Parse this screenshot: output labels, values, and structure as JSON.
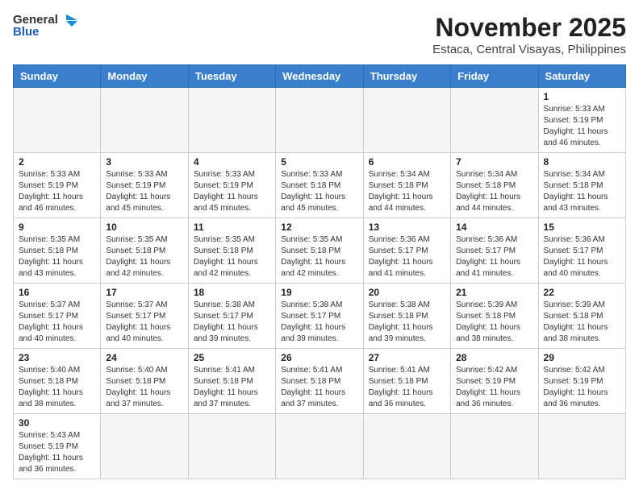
{
  "header": {
    "logo_general": "General",
    "logo_blue": "Blue",
    "month_title": "November 2025",
    "location": "Estaca, Central Visayas, Philippines"
  },
  "weekdays": [
    "Sunday",
    "Monday",
    "Tuesday",
    "Wednesday",
    "Thursday",
    "Friday",
    "Saturday"
  ],
  "days": [
    {
      "num": "",
      "sunrise": "",
      "sunset": "",
      "daylight": ""
    },
    {
      "num": "",
      "sunrise": "",
      "sunset": "",
      "daylight": ""
    },
    {
      "num": "",
      "sunrise": "",
      "sunset": "",
      "daylight": ""
    },
    {
      "num": "",
      "sunrise": "",
      "sunset": "",
      "daylight": ""
    },
    {
      "num": "",
      "sunrise": "",
      "sunset": "",
      "daylight": ""
    },
    {
      "num": "",
      "sunrise": "",
      "sunset": "",
      "daylight": ""
    },
    {
      "num": "1",
      "sunrise": "Sunrise: 5:33 AM",
      "sunset": "Sunset: 5:19 PM",
      "daylight": "Daylight: 11 hours and 46 minutes."
    },
    {
      "num": "2",
      "sunrise": "Sunrise: 5:33 AM",
      "sunset": "Sunset: 5:19 PM",
      "daylight": "Daylight: 11 hours and 46 minutes."
    },
    {
      "num": "3",
      "sunrise": "Sunrise: 5:33 AM",
      "sunset": "Sunset: 5:19 PM",
      "daylight": "Daylight: 11 hours and 45 minutes."
    },
    {
      "num": "4",
      "sunrise": "Sunrise: 5:33 AM",
      "sunset": "Sunset: 5:19 PM",
      "daylight": "Daylight: 11 hours and 45 minutes."
    },
    {
      "num": "5",
      "sunrise": "Sunrise: 5:33 AM",
      "sunset": "Sunset: 5:18 PM",
      "daylight": "Daylight: 11 hours and 45 minutes."
    },
    {
      "num": "6",
      "sunrise": "Sunrise: 5:34 AM",
      "sunset": "Sunset: 5:18 PM",
      "daylight": "Daylight: 11 hours and 44 minutes."
    },
    {
      "num": "7",
      "sunrise": "Sunrise: 5:34 AM",
      "sunset": "Sunset: 5:18 PM",
      "daylight": "Daylight: 11 hours and 44 minutes."
    },
    {
      "num": "8",
      "sunrise": "Sunrise: 5:34 AM",
      "sunset": "Sunset: 5:18 PM",
      "daylight": "Daylight: 11 hours and 43 minutes."
    },
    {
      "num": "9",
      "sunrise": "Sunrise: 5:35 AM",
      "sunset": "Sunset: 5:18 PM",
      "daylight": "Daylight: 11 hours and 43 minutes."
    },
    {
      "num": "10",
      "sunrise": "Sunrise: 5:35 AM",
      "sunset": "Sunset: 5:18 PM",
      "daylight": "Daylight: 11 hours and 42 minutes."
    },
    {
      "num": "11",
      "sunrise": "Sunrise: 5:35 AM",
      "sunset": "Sunset: 5:18 PM",
      "daylight": "Daylight: 11 hours and 42 minutes."
    },
    {
      "num": "12",
      "sunrise": "Sunrise: 5:35 AM",
      "sunset": "Sunset: 5:18 PM",
      "daylight": "Daylight: 11 hours and 42 minutes."
    },
    {
      "num": "13",
      "sunrise": "Sunrise: 5:36 AM",
      "sunset": "Sunset: 5:17 PM",
      "daylight": "Daylight: 11 hours and 41 minutes."
    },
    {
      "num": "14",
      "sunrise": "Sunrise: 5:36 AM",
      "sunset": "Sunset: 5:17 PM",
      "daylight": "Daylight: 11 hours and 41 minutes."
    },
    {
      "num": "15",
      "sunrise": "Sunrise: 5:36 AM",
      "sunset": "Sunset: 5:17 PM",
      "daylight": "Daylight: 11 hours and 40 minutes."
    },
    {
      "num": "16",
      "sunrise": "Sunrise: 5:37 AM",
      "sunset": "Sunset: 5:17 PM",
      "daylight": "Daylight: 11 hours and 40 minutes."
    },
    {
      "num": "17",
      "sunrise": "Sunrise: 5:37 AM",
      "sunset": "Sunset: 5:17 PM",
      "daylight": "Daylight: 11 hours and 40 minutes."
    },
    {
      "num": "18",
      "sunrise": "Sunrise: 5:38 AM",
      "sunset": "Sunset: 5:17 PM",
      "daylight": "Daylight: 11 hours and 39 minutes."
    },
    {
      "num": "19",
      "sunrise": "Sunrise: 5:38 AM",
      "sunset": "Sunset: 5:17 PM",
      "daylight": "Daylight: 11 hours and 39 minutes."
    },
    {
      "num": "20",
      "sunrise": "Sunrise: 5:38 AM",
      "sunset": "Sunset: 5:18 PM",
      "daylight": "Daylight: 11 hours and 39 minutes."
    },
    {
      "num": "21",
      "sunrise": "Sunrise: 5:39 AM",
      "sunset": "Sunset: 5:18 PM",
      "daylight": "Daylight: 11 hours and 38 minutes."
    },
    {
      "num": "22",
      "sunrise": "Sunrise: 5:39 AM",
      "sunset": "Sunset: 5:18 PM",
      "daylight": "Daylight: 11 hours and 38 minutes."
    },
    {
      "num": "23",
      "sunrise": "Sunrise: 5:40 AM",
      "sunset": "Sunset: 5:18 PM",
      "daylight": "Daylight: 11 hours and 38 minutes."
    },
    {
      "num": "24",
      "sunrise": "Sunrise: 5:40 AM",
      "sunset": "Sunset: 5:18 PM",
      "daylight": "Daylight: 11 hours and 37 minutes."
    },
    {
      "num": "25",
      "sunrise": "Sunrise: 5:41 AM",
      "sunset": "Sunset: 5:18 PM",
      "daylight": "Daylight: 11 hours and 37 minutes."
    },
    {
      "num": "26",
      "sunrise": "Sunrise: 5:41 AM",
      "sunset": "Sunset: 5:18 PM",
      "daylight": "Daylight: 11 hours and 37 minutes."
    },
    {
      "num": "27",
      "sunrise": "Sunrise: 5:41 AM",
      "sunset": "Sunset: 5:18 PM",
      "daylight": "Daylight: 11 hours and 36 minutes."
    },
    {
      "num": "28",
      "sunrise": "Sunrise: 5:42 AM",
      "sunset": "Sunset: 5:19 PM",
      "daylight": "Daylight: 11 hours and 36 minutes."
    },
    {
      "num": "29",
      "sunrise": "Sunrise: 5:42 AM",
      "sunset": "Sunset: 5:19 PM",
      "daylight": "Daylight: 11 hours and 36 minutes."
    },
    {
      "num": "30",
      "sunrise": "Sunrise: 5:43 AM",
      "sunset": "Sunset: 5:19 PM",
      "daylight": "Daylight: 11 hours and 36 minutes."
    }
  ]
}
